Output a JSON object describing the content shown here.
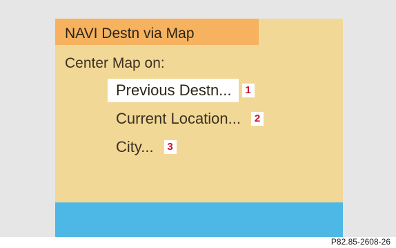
{
  "screen": {
    "title": "NAVI Destn via Map",
    "subtitle": "Center Map on:",
    "menu": [
      {
        "label": "Previous Destn...",
        "badge": "1",
        "selected": true
      },
      {
        "label": "Current Location...",
        "badge": "2",
        "selected": false
      },
      {
        "label": "City...",
        "badge": "3",
        "selected": false
      }
    ]
  },
  "figure": {
    "caption": "P82.85-2608-26"
  },
  "colors": {
    "frame": "#e6e6e6",
    "screen_bg": "#f2d896",
    "title_bar": "#f6b25e",
    "bottom_bar": "#4db8e6",
    "badge_text": "#c8102e",
    "selection": "#ffffff"
  }
}
